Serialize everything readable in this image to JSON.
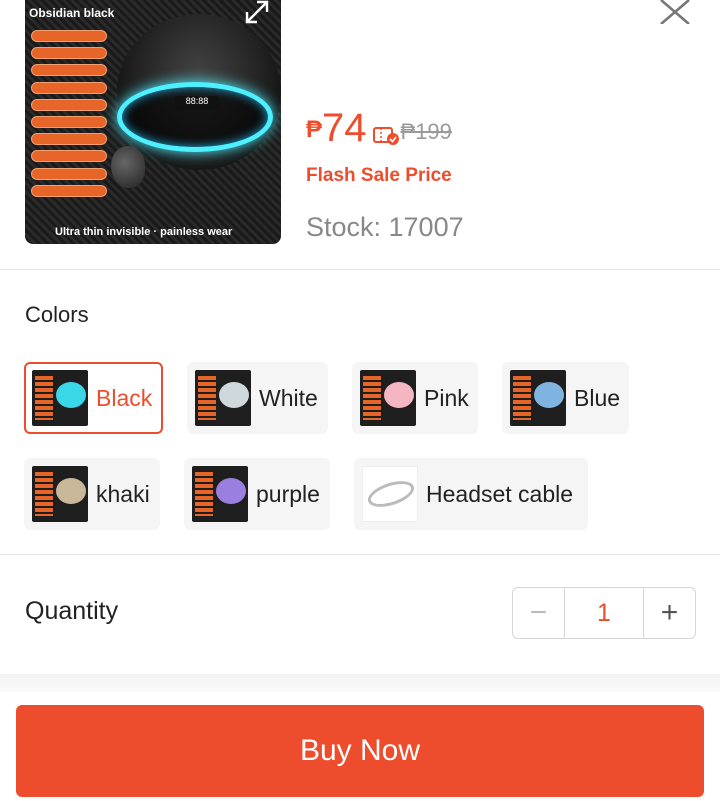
{
  "product": {
    "image_title": "Obsidian black",
    "image_display": "88:88",
    "image_caption": "Ultra thin invisible · painless wear",
    "price_currency": "₱",
    "price_current": "74",
    "price_original": "₱199",
    "flash_label": "Flash Sale Price",
    "stock_text": "Stock: 17007"
  },
  "colors": {
    "title": "Colors",
    "options": [
      {
        "label": "Black",
        "swatch": "#3ad7e8"
      },
      {
        "label": "White",
        "swatch": "#cfd8dc"
      },
      {
        "label": "Pink",
        "swatch": "#f4b6c2"
      },
      {
        "label": "Blue",
        "swatch": "#7fb3e0"
      },
      {
        "label": "khaki",
        "swatch": "#c9b79a"
      },
      {
        "label": "purple",
        "swatch": "#9b7fe0"
      },
      {
        "label": "Headset cable",
        "swatch": "#bbbbbb"
      }
    ],
    "selected": "Black"
  },
  "quantity": {
    "label": "Quantity",
    "value": "1",
    "minus": "−",
    "plus": "+"
  },
  "buy_button": "Buy Now",
  "theme": {
    "accent": "#ee4d2d"
  }
}
